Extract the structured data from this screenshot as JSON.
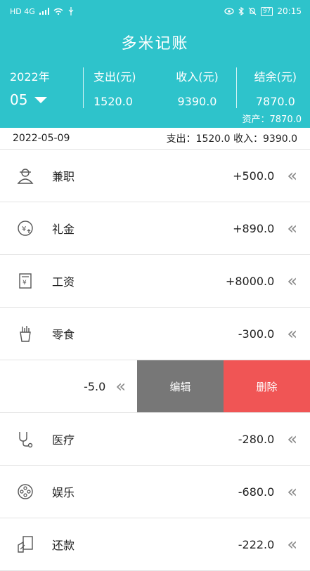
{
  "status": {
    "network": "HD 4G",
    "battery": "97",
    "time": "20:15"
  },
  "header": {
    "title": "多米记账",
    "year": "2022年",
    "month": "05",
    "expense_label": "支出(元)",
    "expense_value": "1520.0",
    "income_label": "收入(元)",
    "income_value": "9390.0",
    "balance_label": "结余(元)",
    "balance_value": "7870.0",
    "assets": "资产：7870.0"
  },
  "day": {
    "date": "2022-05-09",
    "summary": "支出：1520.0 收入：9390.0"
  },
  "records": [
    {
      "name": "兼职",
      "amount": "+500.0",
      "icon": "part-time-icon"
    },
    {
      "name": "礼金",
      "amount": "+890.0",
      "icon": "gift-money-icon"
    },
    {
      "name": "工资",
      "amount": "+8000.0",
      "icon": "salary-icon"
    },
    {
      "name": "零食",
      "amount": "-300.0",
      "icon": "snack-icon"
    }
  ],
  "swiped": {
    "amount": "-5.0",
    "edit_label": "编辑",
    "delete_label": "删除"
  },
  "records2": [
    {
      "name": "医疗",
      "amount": "-280.0",
      "icon": "medical-icon"
    },
    {
      "name": "娱乐",
      "amount": "-680.0",
      "icon": "entertainment-icon"
    },
    {
      "name": "还款",
      "amount": "-222.0",
      "icon": "repayment-icon"
    }
  ],
  "chevron": "«",
  "colors": {
    "primary": "#2ec3cb",
    "delete": "#f05555",
    "edit": "#777777"
  }
}
